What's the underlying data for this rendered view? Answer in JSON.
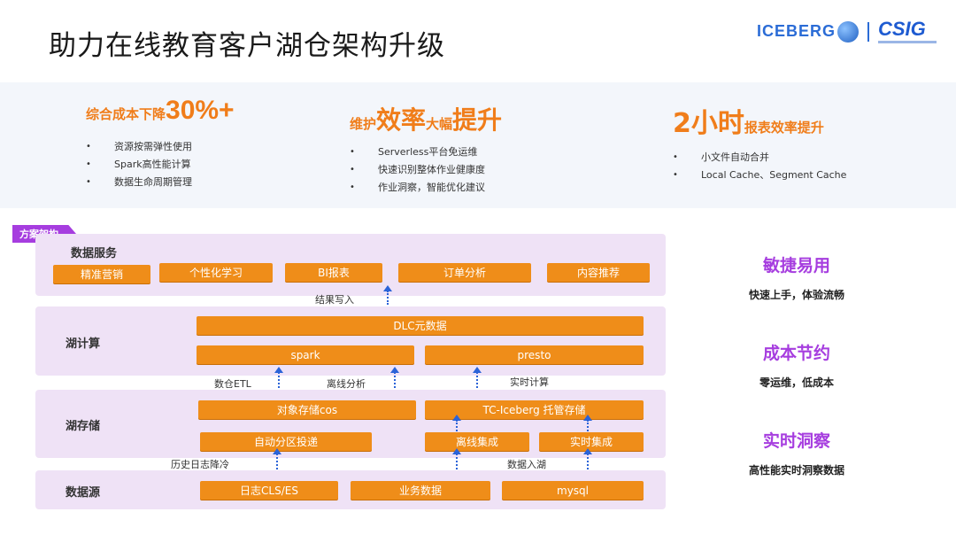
{
  "slide": {
    "title": "助力在线教育客户湖仓架构升级",
    "logo_iceberg": "ICEBERG",
    "logo_csig": "CSIG"
  },
  "highlights": [
    {
      "head_small": "综合成本下降",
      "head_big": "30%+",
      "bullets": [
        "资源按需弹性使用",
        "Spark高性能计算",
        "数据生命周期管理"
      ]
    },
    {
      "head_a": "维护",
      "head_b": "效率",
      "head_c": "大幅",
      "head_d": "提升",
      "bullets": [
        "Serverless平台免运维",
        "快速识别整体作业健康度",
        "作业洞察，智能优化建议"
      ]
    },
    {
      "head_big": "2小时",
      "head_small": "报表效率提升",
      "bullets": [
        "小文件自动合并",
        "Local Cache、Segment Cache"
      ]
    }
  ],
  "architecture": {
    "tag": "方案架构",
    "service": {
      "label": "数据服务",
      "items": [
        "精准营销",
        "个性化学习",
        "BI报表",
        "订单分析",
        "内容推荐"
      ]
    },
    "flow_result": "结果写入",
    "compute": {
      "label": "湖计算",
      "meta": "DLC元数据",
      "spark": "spark",
      "presto": "presto"
    },
    "flow_mid": [
      "数仓ETL",
      "离线分析",
      "实时计算"
    ],
    "storage": {
      "label": "湖存储",
      "cos": "对象存储cos",
      "iceberg": "TC-Iceberg 托管存储",
      "partition": "自动分区投递",
      "offline": "离线集成",
      "realtime": "实时集成"
    },
    "flow_bottom": [
      "历史日志降冷",
      "数据入湖"
    ],
    "source": {
      "label": "数据源",
      "items": [
        "日志CLS/ES",
        "业务数据",
        "mysql"
      ]
    }
  },
  "benefits": [
    {
      "title": "敏捷易用",
      "desc": "快速上手，体验流畅"
    },
    {
      "title": "成本节约",
      "desc": "零运维，低成本"
    },
    {
      "title": "实时洞察",
      "desc": "高性能实时洞察数据"
    }
  ],
  "colors": {
    "accent_orange": "#ef8d19",
    "accent_purple": "#a63ddf",
    "arrow_blue": "#2b63d8"
  }
}
